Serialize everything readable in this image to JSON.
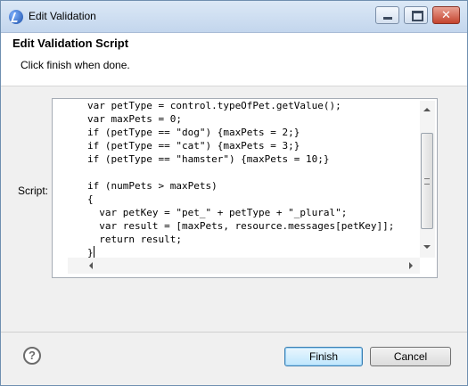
{
  "window": {
    "title": "Edit Validation",
    "close_glyph": "✕",
    "icons": [
      "app-icon",
      "minimize-icon",
      "maximize-icon",
      "close-icon"
    ]
  },
  "header": {
    "title": "Edit Validation Script",
    "message": "Click finish when done."
  },
  "editor": {
    "label": "Script:",
    "code": "var petType = control.typeOfPet.getValue();\nvar maxPets = 0;\nif (petType == \"dog\") {maxPets = 2;}\nif (petType == \"cat\") {maxPets = 3;}\nif (petType == \"hamster\") {maxPets = 10;}\n\nif (numPets > maxPets)\n{\n  var petKey = \"pet_\" + petType + \"_plural\";\n  var result = [maxPets, resource.messages[petKey]];\n  return result;\n}"
  },
  "footer": {
    "help_glyph": "?",
    "finish_label": "Finish",
    "cancel_label": "Cancel"
  }
}
